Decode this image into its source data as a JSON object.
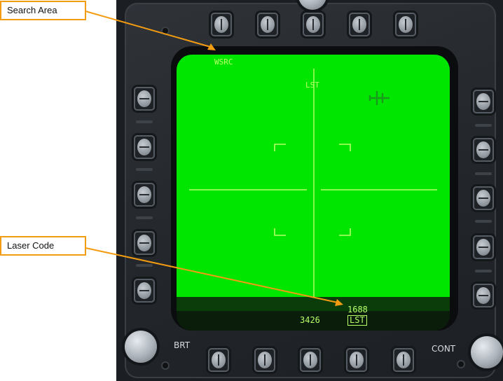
{
  "callouts": {
    "search_area": "Search Area",
    "laser_code": "Laser Code"
  },
  "display": {
    "mode_label": "WSRC",
    "track_label": "LST",
    "laser_code_value": "1688",
    "laser_mode_box": "LST",
    "range_readout": "3426",
    "background_color": "#00e600",
    "symbol_color": "#b8ff6a"
  },
  "bezel": {
    "left_knob_label": "BRT",
    "right_knob_label": "CONT"
  },
  "colors": {
    "callout_border": "#f39c12",
    "bezel": "#23272b"
  }
}
